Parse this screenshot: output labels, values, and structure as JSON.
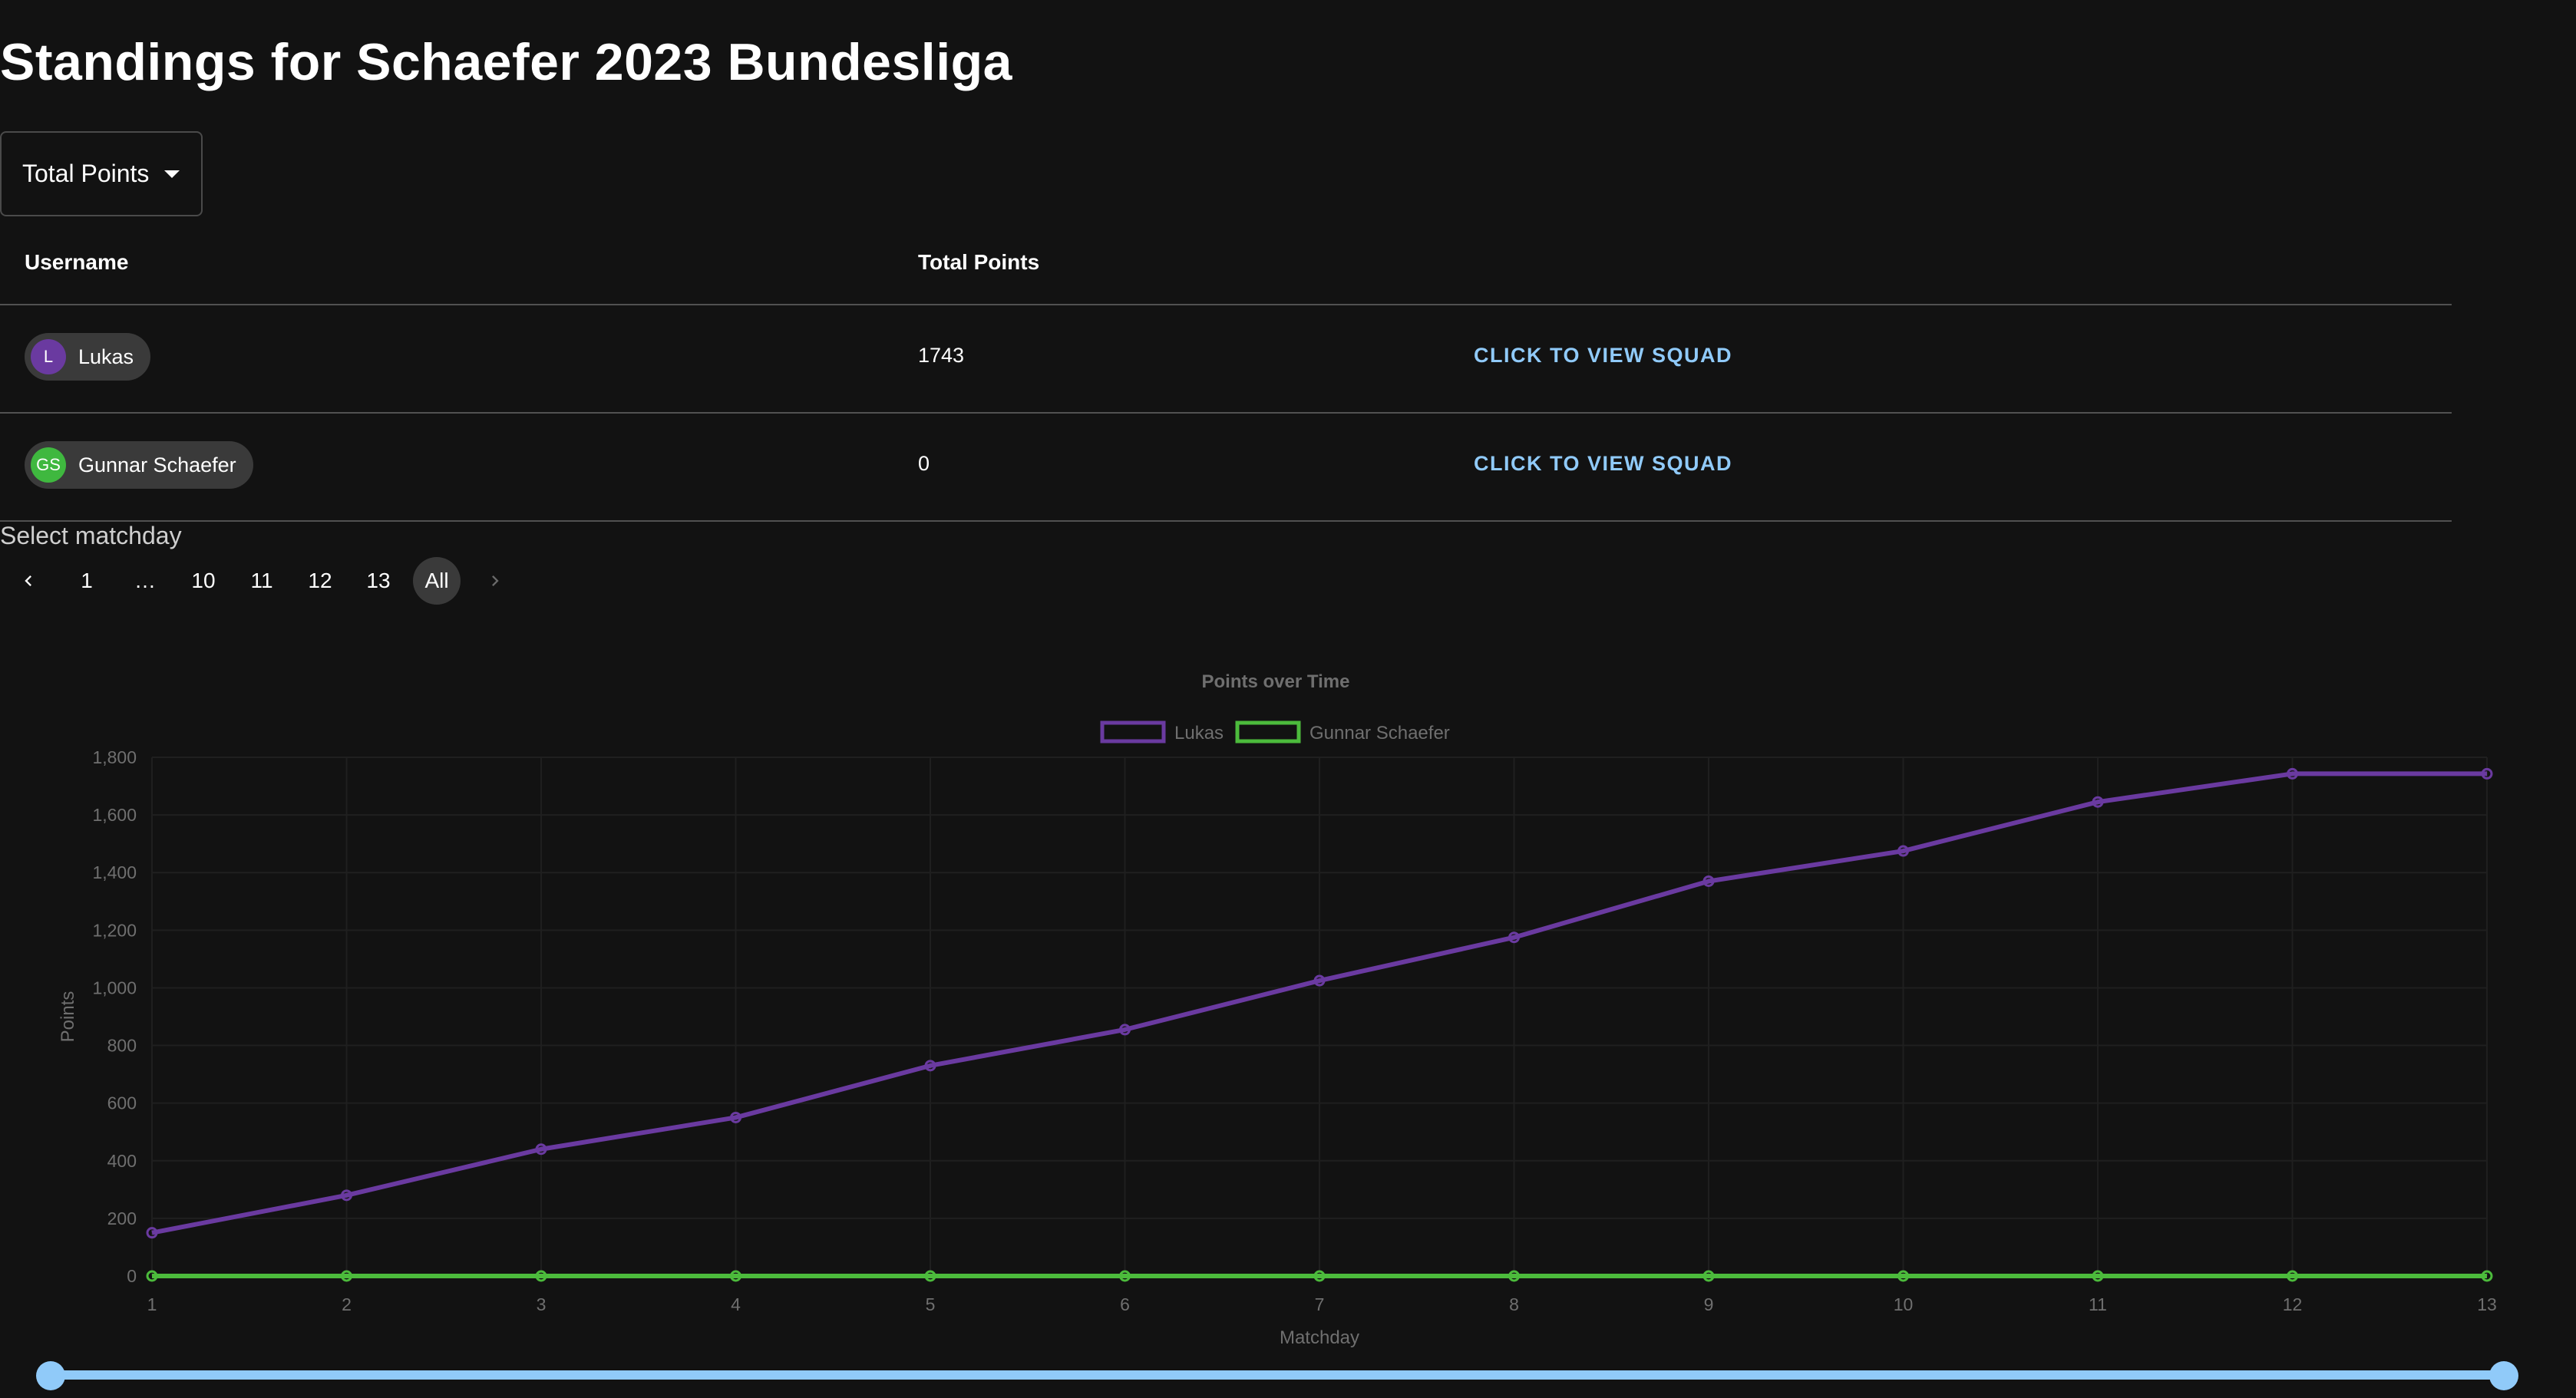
{
  "page": {
    "title": "Standings for Schaefer 2023 Bundesliga"
  },
  "metric_select": {
    "value": "Total Points",
    "icon": "caret-down-icon"
  },
  "table": {
    "headers": [
      "Username",
      "Total Points"
    ],
    "rows": [
      {
        "initials": "L",
        "name": "Lukas",
        "points": "1743",
        "action": "CLICK TO VIEW SQUAD",
        "avatar_color": "#6a3aa0"
      },
      {
        "initials": "GS",
        "name": "Gunnar Schaefer",
        "points": "0",
        "action": "CLICK TO VIEW SQUAD",
        "avatar_color": "#3fb83f"
      }
    ]
  },
  "matchday": {
    "label": "Select matchday",
    "pages": [
      "1",
      "…",
      "10",
      "11",
      "12",
      "13",
      "All"
    ],
    "selected": "All",
    "prev_icon": "chevron-left-icon",
    "next_icon": "chevron-right-icon"
  },
  "range_slider": {
    "min_value": 1,
    "max_value": 13
  },
  "colors": {
    "background": "#121212",
    "accent": "#90caf9",
    "lukas": "#6a3aa0",
    "gunnar": "#4cbb3c",
    "axis_text": "#6f6f6f",
    "grid": "#1f1f1f"
  },
  "chart_data": {
    "type": "line",
    "title": "Points over Time",
    "xlabel": "Matchday",
    "ylabel": "Points",
    "x": [
      1,
      2,
      3,
      4,
      5,
      6,
      7,
      8,
      9,
      10,
      11,
      12,
      13
    ],
    "ylim": [
      0,
      1800
    ],
    "yticks": [
      0,
      200,
      400,
      600,
      800,
      1000,
      1200,
      1400,
      1600,
      1800
    ],
    "ytick_labels": [
      "0",
      "200",
      "400",
      "600",
      "800",
      "1,000",
      "1,200",
      "1,400",
      "1,600",
      "1,800"
    ],
    "legend_position": "top-center",
    "grid": true,
    "series": [
      {
        "name": "Lukas",
        "color": "#6a3aa0",
        "values": [
          150,
          280,
          440,
          550,
          730,
          855,
          1025,
          1175,
          1370,
          1475,
          1645,
          1743,
          1743
        ]
      },
      {
        "name": "Gunnar Schaefer",
        "color": "#4cbb3c",
        "values": [
          0,
          0,
          0,
          0,
          0,
          0,
          0,
          0,
          0,
          0,
          0,
          0,
          0
        ]
      }
    ]
  }
}
